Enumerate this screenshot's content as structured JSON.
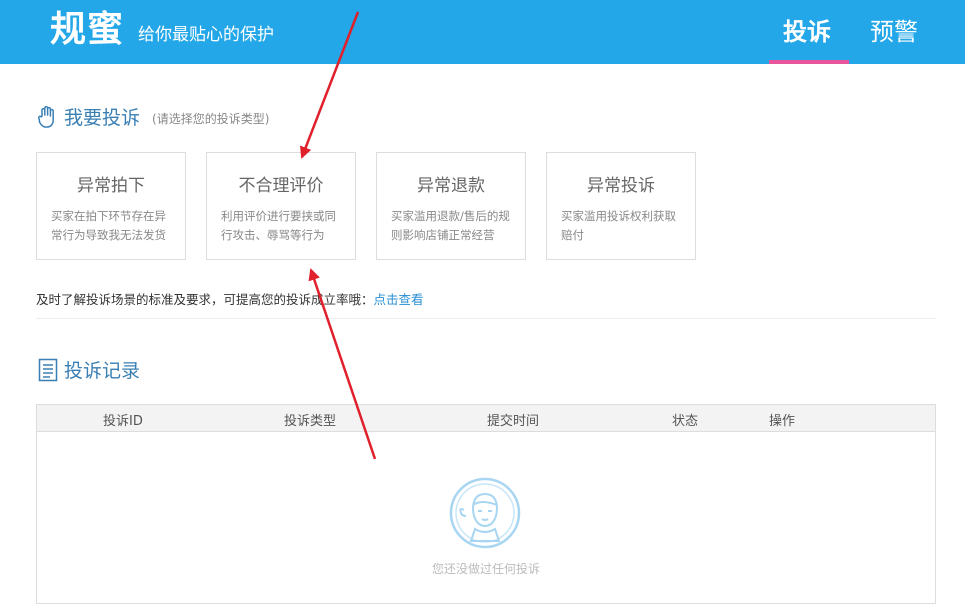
{
  "header": {
    "logo": "规蜜",
    "slogan": "给你最贴心的保护",
    "tabs": [
      {
        "label": "投诉",
        "active": true
      },
      {
        "label": "预警",
        "active": false
      }
    ],
    "bg_color": "#23a7e8",
    "active_underline_color": "#e7559c"
  },
  "complaint_section": {
    "title": "我要投诉",
    "hint": "(请选择您的投诉类型)",
    "icon": "hand-icon",
    "cards": [
      {
        "title": "异常拍下",
        "desc": "买家在拍下环节存在异常行为导致我无法发货"
      },
      {
        "title": "不合理评价",
        "desc": "利用评价进行要挟或同行攻击、辱骂等行为"
      },
      {
        "title": "异常退款",
        "desc": "买家滥用退款/售后的规则影响店铺正常经营"
      },
      {
        "title": "异常投诉",
        "desc": "买家滥用投诉权利获取赔付"
      }
    ],
    "tip": "及时了解投诉场景的标准及要求，可提高您的投诉成立率哦：",
    "tip_link": "点击查看"
  },
  "records_section": {
    "title": "投诉记录",
    "icon": "document-icon",
    "columns": [
      "投诉ID",
      "投诉类型",
      "提交时间",
      "状态",
      "操作"
    ],
    "rows": [],
    "empty_text": "您还没做过任何投诉",
    "empty_icon": "empty-face-icon"
  },
  "annotations": {
    "arrow_color": "#e0202a"
  }
}
